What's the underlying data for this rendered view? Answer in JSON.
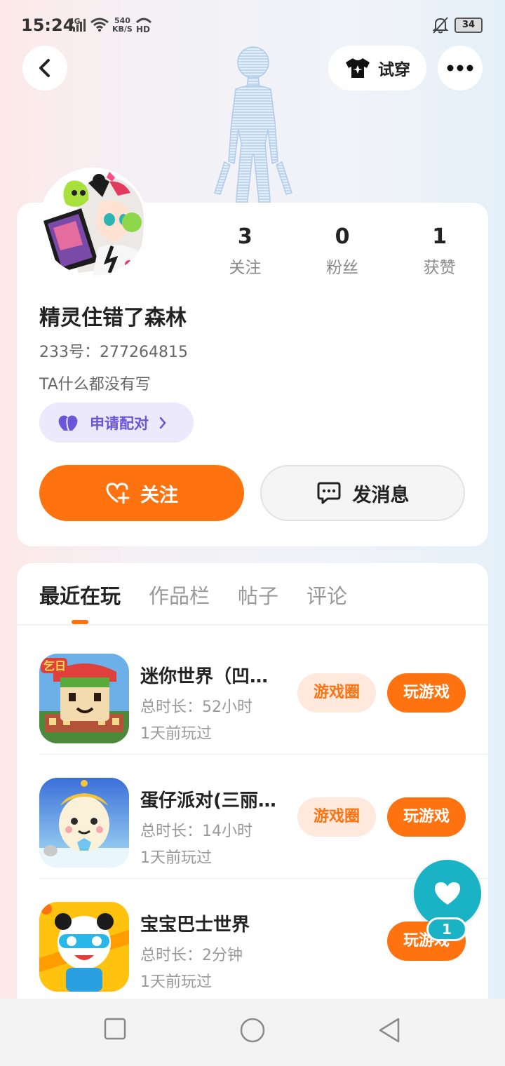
{
  "status_bar": {
    "time": "15:24",
    "network": "4G",
    "speed_value": "540",
    "speed_unit": "KB/S",
    "hd": "HD",
    "battery": "34"
  },
  "header": {
    "tryon_label": "试穿"
  },
  "profile": {
    "stats": [
      {
        "value": "3",
        "label": "关注"
      },
      {
        "value": "0",
        "label": "粉丝"
      },
      {
        "value": "1",
        "label": "获赞"
      }
    ],
    "username": "精灵住错了森林",
    "user_id": "233号：277264815",
    "bio": "TA什么都没有写",
    "pair_label": "申请配对",
    "follow_label": "关注",
    "message_label": "发消息"
  },
  "tabs": [
    {
      "label": "最近在玩",
      "active": true
    },
    {
      "label": "作品栏",
      "active": false
    },
    {
      "label": "帖子",
      "active": false
    },
    {
      "label": "评论",
      "active": false
    }
  ],
  "games": [
    {
      "title": "迷你世界（凹…",
      "duration": "总时长：52小时",
      "last_played": "1天前玩过",
      "circle_label": "游戏圈",
      "play_label": "玩游戏"
    },
    {
      "title": "蛋仔派对(三丽…",
      "duration": "总时长：14小时",
      "last_played": "1天前玩过",
      "circle_label": "游戏圈",
      "play_label": "玩游戏"
    },
    {
      "title": "宝宝巴士世界",
      "duration": "总时长：2分钟",
      "last_played": "1天前玩过",
      "play_label": "玩游戏"
    }
  ],
  "floating_like": {
    "count": "1"
  },
  "colors": {
    "accent": "#ff7210",
    "pair_purple": "#6b55d8",
    "like_teal": "#1ab3c6"
  },
  "icons": [
    "back-arrow-icon",
    "tshirt-icon",
    "more-dots-icon",
    "heart-purple-icon",
    "heart-plus-icon",
    "chat-bubble-icon",
    "heart-icon",
    "square-nav-icon",
    "circle-nav-icon",
    "triangle-back-nav-icon"
  ]
}
